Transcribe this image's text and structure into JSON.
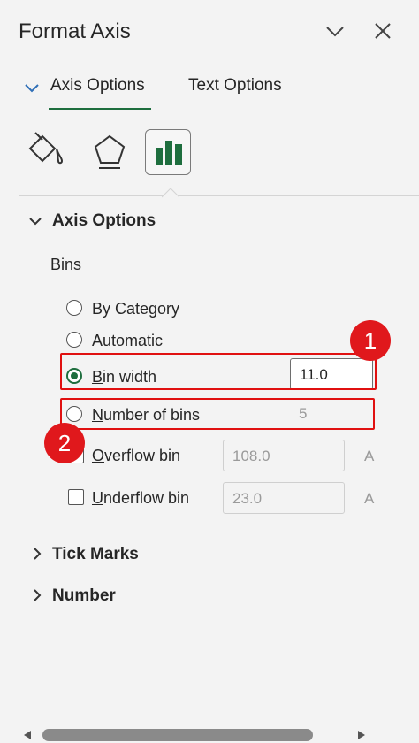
{
  "header": {
    "title": "Format Axis"
  },
  "tabs": [
    {
      "label": "Axis Options",
      "active": true
    },
    {
      "label": "Text Options",
      "active": false
    }
  ],
  "icon_tabs": [
    "fill-line-icon",
    "effects-pentagon-icon",
    "bar-chart-icon"
  ],
  "sections": {
    "axis_options": {
      "label": "Axis Options",
      "expanded": true
    },
    "tick_marks": {
      "label": "Tick Marks",
      "expanded": false
    },
    "number": {
      "label": "Number",
      "expanded": false
    }
  },
  "bins": {
    "label": "Bins",
    "by_category": "By Category",
    "automatic": "Automatic",
    "bin_width": {
      "prefix": "B",
      "rest": "in width",
      "value": "11.0"
    },
    "number_of_bins": {
      "prefix": "N",
      "rest": "umber of bins",
      "value": "5"
    },
    "overflow_bin": {
      "prefix": "O",
      "rest": "verflow bin",
      "value": "108.0",
      "unit": "A"
    },
    "underflow_bin": {
      "prefix": "U",
      "rest": "nderflow bin",
      "value": "23.0",
      "unit": "A"
    }
  },
  "badges": {
    "one": "1",
    "two": "2"
  },
  "colors": {
    "accent": "#1e6e3e",
    "highlight": "#e01010"
  }
}
